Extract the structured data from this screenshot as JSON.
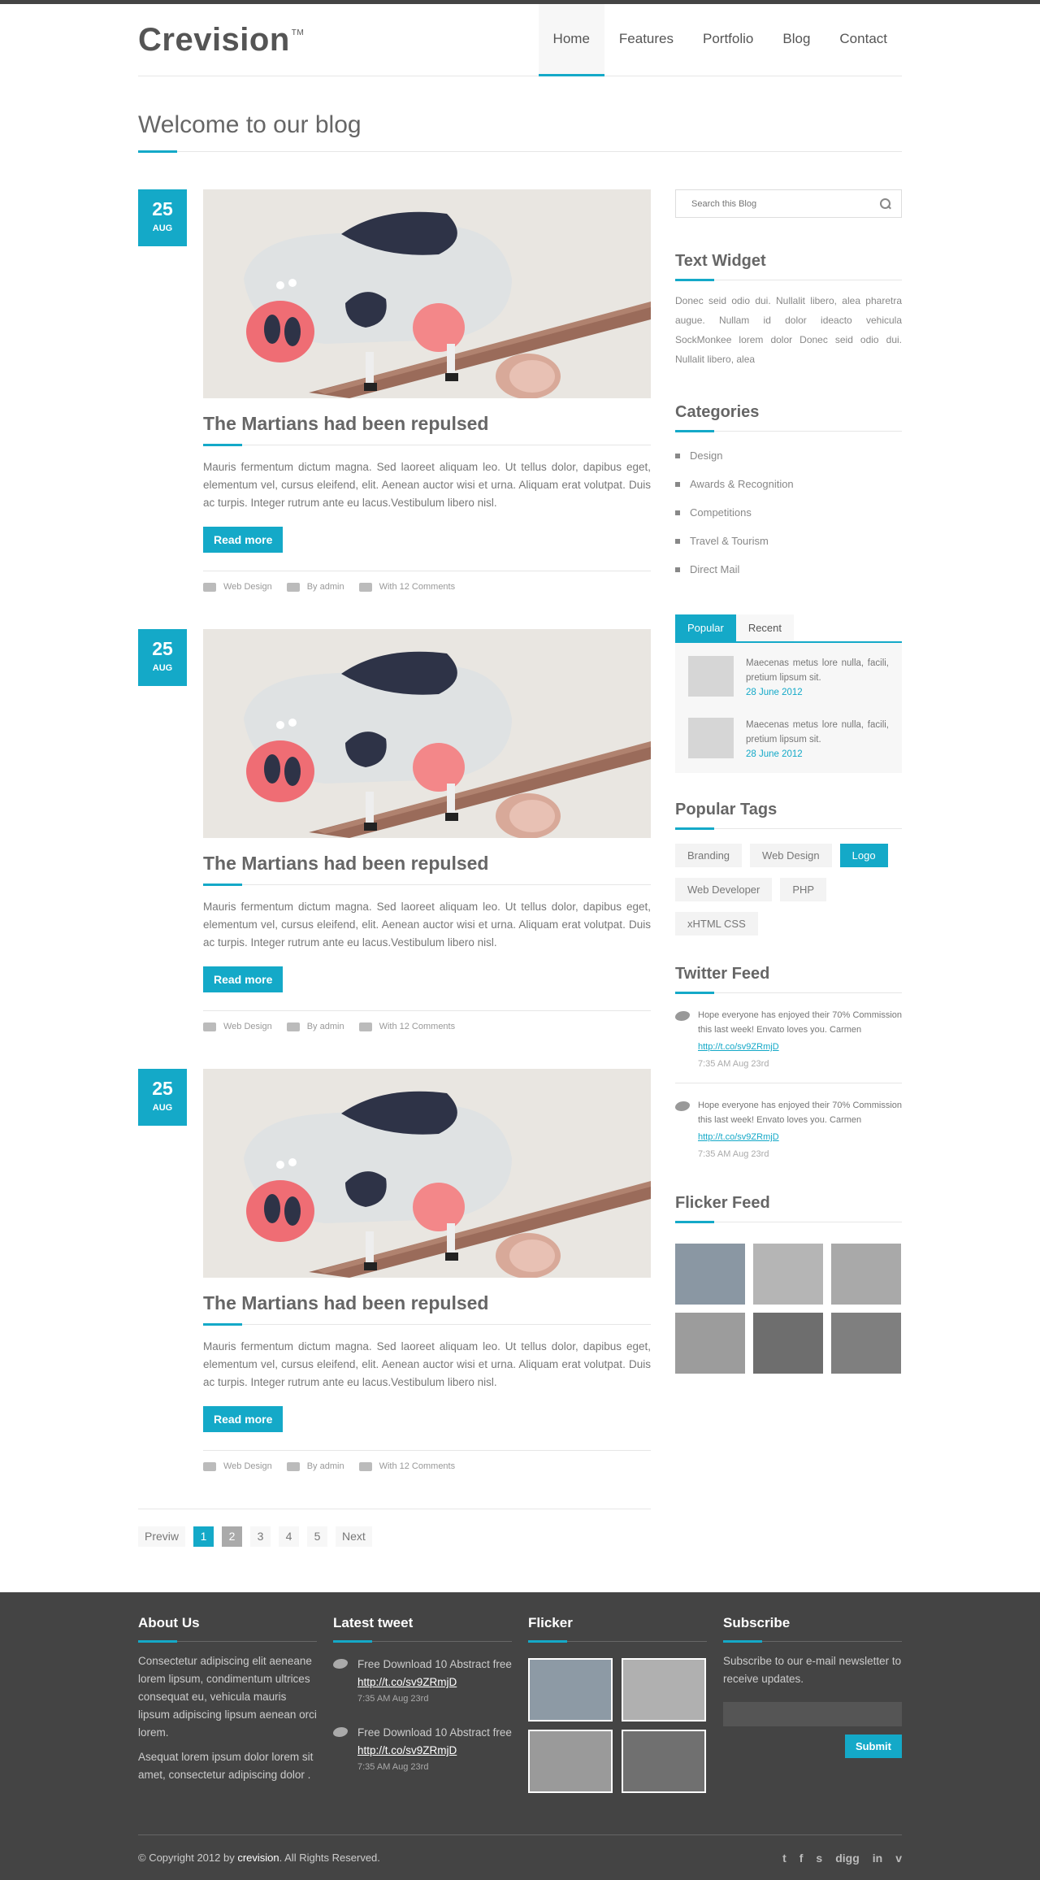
{
  "brand": {
    "name": "Crevision",
    "tm": "TM"
  },
  "nav": [
    "Home",
    "Features",
    "Portfolio",
    "Blog",
    "Contact"
  ],
  "page": {
    "title": "Welcome to our blog"
  },
  "posts": [
    {
      "day": "25",
      "month": "AUG",
      "title": "The Martians had been repulsed",
      "excerpt": "Mauris fermentum dictum magna. Sed laoreet aliquam leo. Ut tellus dolor, dapibus eget, elementum vel, cursus eleifend, elit. Aenean auctor wisi et urna. Aliquam erat volutpat. Duis ac turpis. Integer rutrum ante eu lacus.Vestibulum libero nisl.",
      "read_more": "Read more",
      "category": "Web Design",
      "author": "By admin",
      "comments": "With 12 Comments"
    },
    {
      "day": "25",
      "month": "AUG",
      "title": "The Martians had been repulsed",
      "excerpt": "Mauris fermentum dictum magna. Sed laoreet aliquam leo. Ut tellus dolor, dapibus eget, elementum vel, cursus eleifend, elit. Aenean auctor wisi et urna. Aliquam erat volutpat. Duis ac turpis. Integer rutrum ante eu lacus.Vestibulum libero nisl.",
      "read_more": "Read more",
      "category": "Web Design",
      "author": "By admin",
      "comments": "With 12 Comments"
    },
    {
      "day": "25",
      "month": "AUG",
      "title": "The Martians had been repulsed",
      "excerpt": "Mauris fermentum dictum magna. Sed laoreet aliquam leo. Ut tellus dolor, dapibus eget, elementum vel, cursus eleifend, elit. Aenean auctor wisi et urna. Aliquam erat volutpat. Duis ac turpis. Integer rutrum ante eu lacus.Vestibulum libero nisl.",
      "read_more": "Read more",
      "category": "Web Design",
      "author": "By admin",
      "comments": "With 12 Comments"
    }
  ],
  "pagination": {
    "prev": "Previw",
    "pages": [
      "1",
      "2",
      "3",
      "4",
      "5"
    ],
    "next": "Next"
  },
  "sidebar": {
    "search_placeholder": "Search this Blog",
    "text_widget": {
      "title": "Text Widget",
      "body": "Donec seid odio dui. Nullalit libero, alea pharetra augue. Nullam id dolor ideacto vehicula SockMonkee lorem dolor Donec seid odio dui. Nullalit libero, alea"
    },
    "categories": {
      "title": "Categories",
      "items": [
        "Design",
        "Awards & Recognition",
        "Competitions",
        "Travel & Tourism",
        "Direct Mail"
      ]
    },
    "tabs": {
      "labels": [
        "Popular",
        "Recent"
      ],
      "items": [
        {
          "text": "Maecenas metus lore nulla, facili, pretium lipsum sit.",
          "date": "28 June 2012"
        },
        {
          "text": "Maecenas metus lore nulla, facili, pretium lipsum sit.",
          "date": "28 June 2012"
        }
      ]
    },
    "tags": {
      "title": "Popular Tags",
      "items": [
        "Branding",
        "Web Design",
        "Logo",
        "Web Developer",
        "PHP",
        "xHTML CSS"
      ]
    },
    "twitter": {
      "title": "Twitter Feed",
      "items": [
        {
          "text": "Hope everyone has enjoyed their 70% Commission this last week! Envato loves you. Carmen",
          "link": "http://t.co/sv9ZRmjD",
          "time": "7:35 AM Aug 23rd"
        },
        {
          "text": "Hope everyone has enjoyed their 70% Commission this last week! Envato loves you. Carmen",
          "link": "http://t.co/sv9ZRmjD",
          "time": "7:35 AM Aug 23rd"
        }
      ]
    },
    "flicker": {
      "title": "Flicker Feed"
    }
  },
  "footer": {
    "about": {
      "title": "About Us",
      "p1": "Consectetur adipiscing elit aeneane lorem lipsum, condimentum ultrices consequat eu, vehicula mauris lipsum adipiscing lipsum aenean orci lorem.",
      "p2": "Asequat lorem ipsum dolor lorem sit amet, consectetur adipiscing dolor ."
    },
    "tweets": {
      "title": "Latest tweet",
      "items": [
        {
          "text": "Free Download 10 Abstract free",
          "link": "http://t.co/sv9ZRmjD",
          "time": "7:35 AM Aug 23rd"
        },
        {
          "text": "Free Download 10 Abstract free",
          "link": "http://t.co/sv9ZRmjD",
          "time": "7:35 AM Aug 23rd"
        }
      ]
    },
    "flicker": {
      "title": "Flicker"
    },
    "subscribe": {
      "title": "Subscribe",
      "text": "Subscribe to our e-mail newsletter to receive updates.",
      "button": "Submit"
    },
    "copyright_pre": "© Copyright 2012 by ",
    "copyright_brand": "crevision",
    "copyright_post": ". All Rights Reserved.",
    "social": [
      "twitter-icon",
      "facebook-icon",
      "skype-icon",
      "digg-icon",
      "linkedin-icon",
      "vimeo-icon"
    ],
    "social_glyphs": [
      "t",
      "f",
      "s",
      "digg",
      "in",
      "v"
    ]
  },
  "colors": {
    "accent": "#14a9c8",
    "footer_bg": "#444444"
  }
}
